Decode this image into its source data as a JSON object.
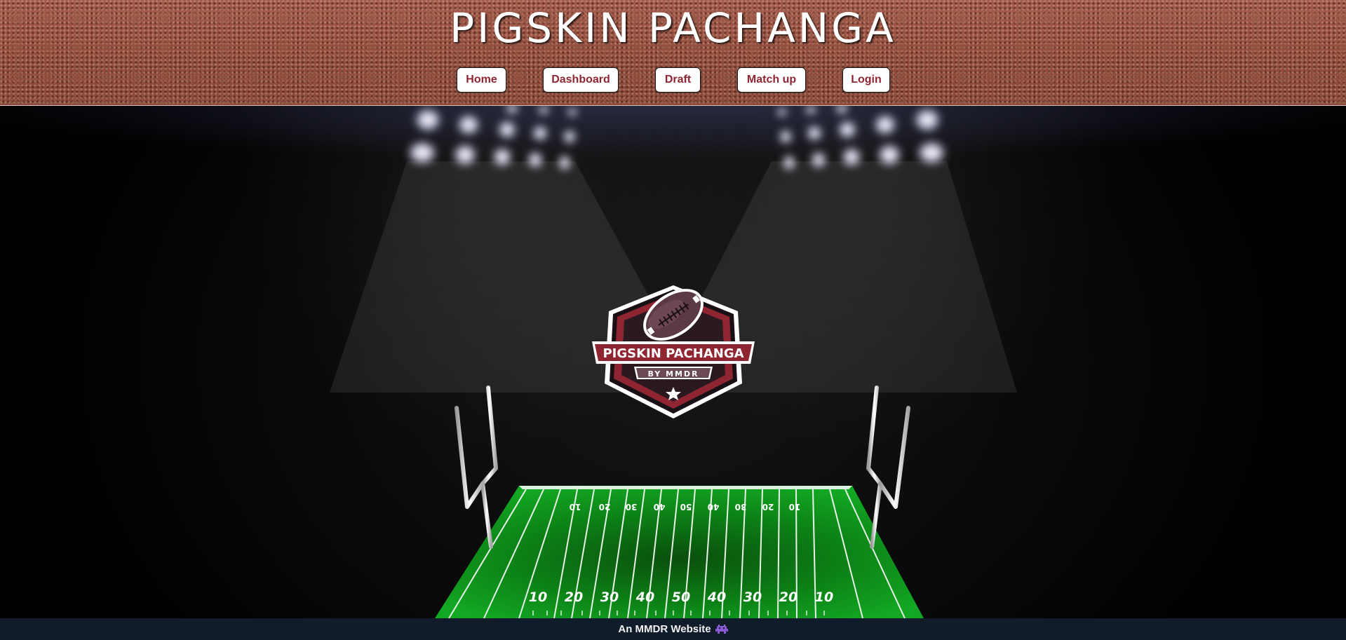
{
  "header": {
    "title": "PIGSKIN PACHANGA",
    "nav": [
      {
        "label": "Home"
      },
      {
        "label": "Dashboard"
      },
      {
        "label": "Draft"
      },
      {
        "label": "Match up"
      },
      {
        "label": "Login"
      }
    ]
  },
  "hero": {
    "logo": {
      "line1": "PIGSKIN PACHANGA",
      "line2": "BY MMDR"
    },
    "field": {
      "top_yard_numbers": [
        "10",
        "20",
        "30",
        "40",
        "50",
        "40",
        "30",
        "20",
        "10"
      ],
      "bottom_yard_numbers": [
        "10",
        "20",
        "30",
        "40",
        "50",
        "40",
        "30",
        "20",
        "10"
      ]
    }
  },
  "footer": {
    "text": "An MMDR Website",
    "icon": "alien-monster-icon"
  },
  "colors": {
    "accent": "#8e2531",
    "leather": "#96523f",
    "turf": "#0f9a1e",
    "footer_bg": "#111c2b"
  }
}
